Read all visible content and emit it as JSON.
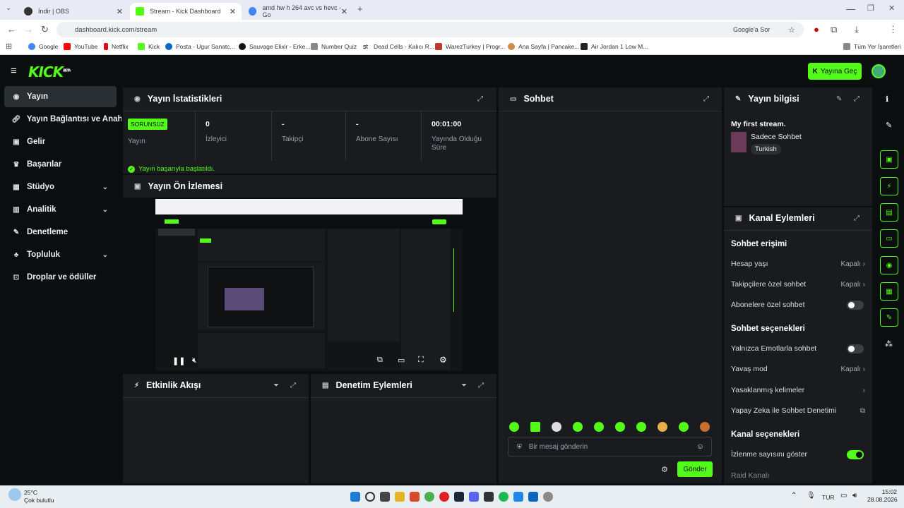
{
  "browser": {
    "tabs": [
      {
        "title": "İndir | OBS"
      },
      {
        "title": "Stream - Kick Dashboard"
      },
      {
        "title": "amd hw h 264 avc vs hevc - Go"
      }
    ],
    "url": "dashboard.kick.com/stream",
    "google_label": "Google'a Sor",
    "bookmarks": [
      "Google",
      "YouTube",
      "Netflix",
      "Kick",
      "Posta - Ugur Sanatc...",
      "Sauvage Elixir - Erke...",
      "Number Quiz",
      "Dead Cells - Kalıcı R...",
      "WarezTurkey | Progr...",
      "Ana Sayfa | Pancake...",
      "Air Jordan 1 Low M..."
    ],
    "all_bookmarks": "Tüm Yer İşaretleri"
  },
  "app": {
    "logo": "KICK",
    "logo_badge": "BETA",
    "go_live": "Yayına Geç"
  },
  "sidebar": {
    "items": [
      {
        "label": "Yayın",
        "icon": "broadcast-icon"
      },
      {
        "label": "Yayın Bağlantısı ve Anahtar",
        "icon": "link-icon"
      },
      {
        "label": "Gelir",
        "icon": "money-icon"
      },
      {
        "label": "Başarılar",
        "icon": "trophy-icon"
      },
      {
        "label": "Stüdyo",
        "icon": "studio-icon"
      },
      {
        "label": "Analitik",
        "icon": "chart-icon"
      },
      {
        "label": "Denetleme",
        "icon": "wrench-icon"
      },
      {
        "label": "Topluluk",
        "icon": "community-icon"
      },
      {
        "label": "Droplar ve ödüller",
        "icon": "gift-icon"
      }
    ]
  },
  "stats": {
    "title": "Yayın İstatistikleri",
    "status_badge": "SORUNSUZ",
    "status_label": "Yayın",
    "viewers_value": "0",
    "viewers_label": "İzleyici",
    "followers_value": "-",
    "followers_label": "Takipçi",
    "subs_value": "-",
    "subs_label": "Abone Sayısı",
    "duration_value": "00:01:00",
    "duration_label": "Yayında Olduğu Süre",
    "success": "Yayın başarıyla başlatıldı."
  },
  "preview": {
    "title": "Yayın Ön İzlemesi"
  },
  "activity": {
    "title": "Etkinlik Akışı"
  },
  "modactions": {
    "title": "Denetim Eylemleri"
  },
  "chat": {
    "title": "Sohbet",
    "placeholder": "Bir mesaj gönderin",
    "send": "Gönder"
  },
  "info": {
    "title": "Yayın bilgisi",
    "stream_title": "My first stream.",
    "category": "Sadece Sohbet",
    "language": "Turkish"
  },
  "channel": {
    "title": "Kanal Eylemleri",
    "sec1": "Sohbet erişimi",
    "account_age": "Hesap yaşı",
    "account_age_val": "Kapalı",
    "followers_only": "Takipçilere özel sohbet",
    "followers_only_val": "Kapalı",
    "subs_only": "Abonelere özel sohbet",
    "sec2": "Sohbet seçenekleri",
    "emotes_only": "Yalnızca Emotlarla sohbet",
    "slow_mode": "Yavaş mod",
    "slow_mode_val": "Kapalı",
    "banned_words": "Yasaklanmış kelimeler",
    "ai_mod": "Yapay Zeka ile Sohbet Denetimi",
    "sec3": "Kanal seçenekleri",
    "show_viewers": "İzlenme sayısını göster",
    "raid": "Raid Kanalı"
  },
  "taskbar": {
    "temp": "25°C",
    "weather": "Çok bulutlu",
    "lang": "TUR",
    "time": "15:02",
    "date": "28.08.2026"
  }
}
